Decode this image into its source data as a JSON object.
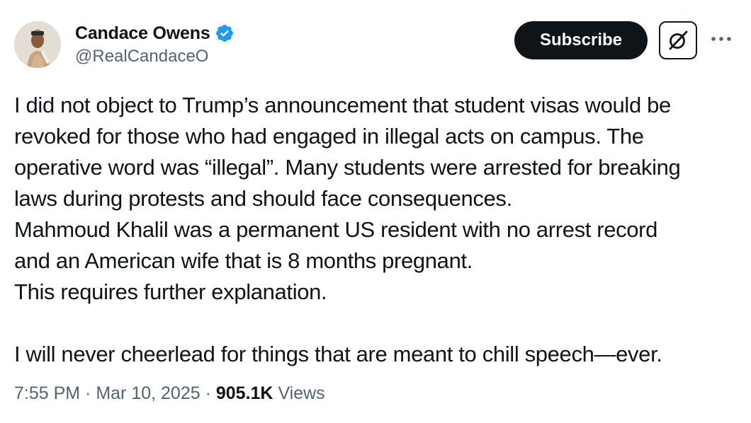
{
  "author": {
    "display_name": "Candace Owens",
    "handle": "@RealCandaceO",
    "verified_badge_color": "#1d9bf0"
  },
  "actions": {
    "subscribe_label": "Subscribe",
    "grok_icon": "grok-icon",
    "more_icon": "more-icon"
  },
  "tweet": {
    "lines": [
      "I did not object to Trump’s announcement that student visas would be",
      "revoked for those who had engaged in illegal acts on campus. The",
      "operative word was “illegal”. Many students were arrested for breaking",
      "laws during protests and should face consequences.",
      "Mahmoud Khalil was a permanent US resident with no arrest record",
      "and an American wife that is 8 months pregnant.",
      "This requires further explanation.",
      "",
      "I will never cheerlead for things that are meant to chill speech—ever."
    ]
  },
  "meta": {
    "time": "7:55 PM",
    "separator": " · ",
    "date": "Mar 10, 2025",
    "views_count": "905.1K",
    "views_label": " Views"
  },
  "colors": {
    "text": "#0f1419",
    "secondary": "#536471",
    "button_bg": "#0f1419"
  }
}
